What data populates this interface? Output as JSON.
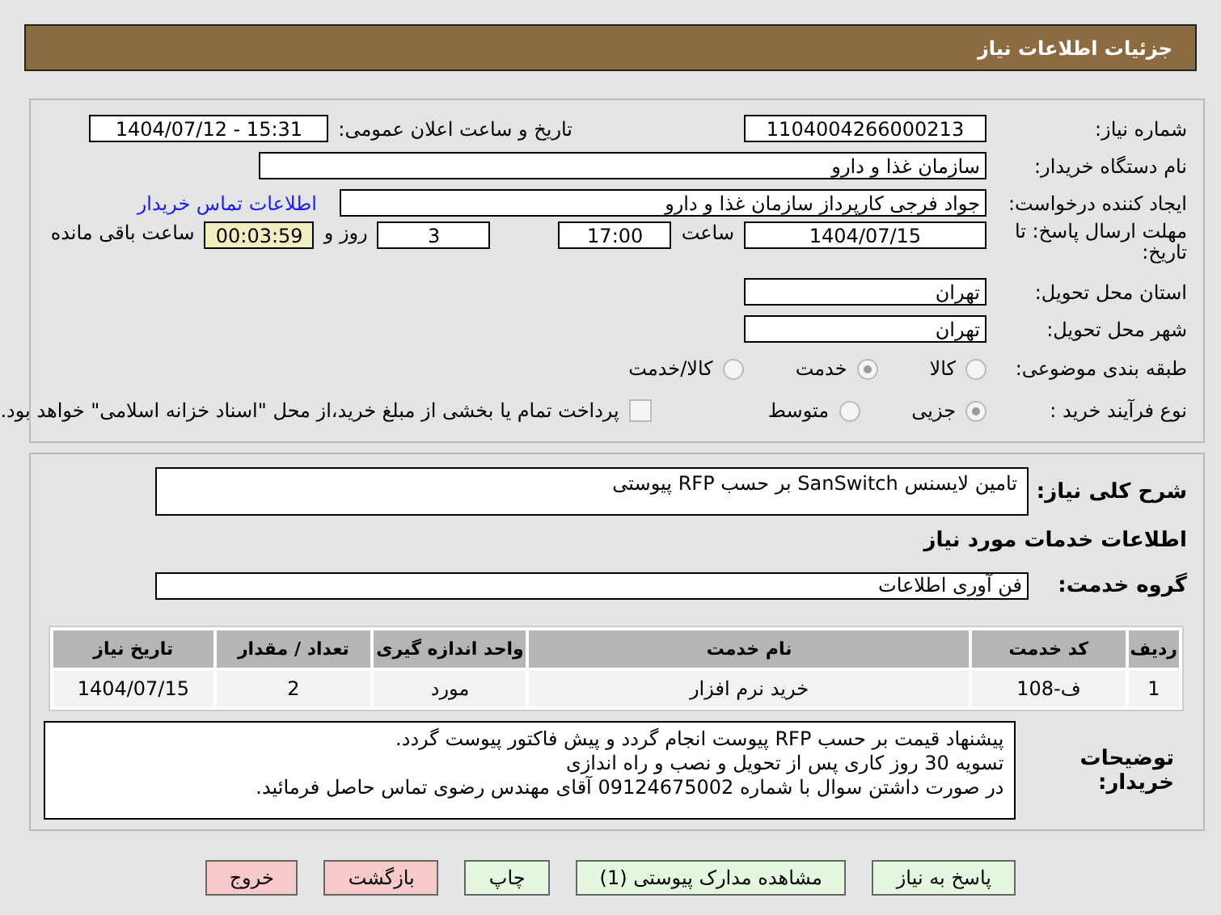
{
  "header": {
    "title": "جزئیات اطلاعات نیاز"
  },
  "need_number": {
    "label": "شماره نیاز:",
    "value": "1104004266000213"
  },
  "announce": {
    "label": "تاریخ و ساعت اعلان عمومی:",
    "value": "1404/07/12 - 15:31"
  },
  "buyer_org": {
    "label": "نام دستگاه خریدار:",
    "value": "سازمان غذا و دارو"
  },
  "requester": {
    "label": "ایجاد کننده درخواست:",
    "value": "جواد فرجی کارپرداز سازمان غذا و دارو",
    "link": "اطلاعات تماس خریدار"
  },
  "deadline": {
    "label": "مهلت ارسال پاسخ: تا تاریخ:",
    "date": "1404/07/15",
    "time_label": "ساعت",
    "time": "17:00",
    "days": "3",
    "days_label": "روز و",
    "remaining": "00:03:59",
    "remaining_label": "ساعت باقی مانده"
  },
  "province": {
    "label": "استان محل تحویل:",
    "value": "تهران"
  },
  "city": {
    "label": "شهر محل تحویل:",
    "value": "تهران"
  },
  "category": {
    "label": "طبقه بندی موضوعی:",
    "options": [
      {
        "label": "کالا",
        "selected": false
      },
      {
        "label": "خدمت",
        "selected": true
      },
      {
        "label": "کالا/خدمت",
        "selected": false
      }
    ]
  },
  "purchase_type": {
    "label": "نوع فرآیند خرید :",
    "options": [
      {
        "label": "جزیی",
        "selected": true
      },
      {
        "label": "متوسط",
        "selected": false
      }
    ],
    "payment": {
      "checked": false,
      "text": "پرداخت تمام یا بخشی از مبلغ خرید،از محل \"اسناد خزانه اسلامی\" خواهد بود."
    }
  },
  "description": {
    "label": "شرح کلی نیاز:",
    "value": "تامین لایسنس SanSwitch بر حسب RFP پیوستی"
  },
  "services_title": "اطلاعات خدمات مورد نیاز",
  "service_group": {
    "label": "گروه خدمت:",
    "value": "فن آوری اطلاعات"
  },
  "table": {
    "columns": [
      "ردیف",
      "کد خدمت",
      "نام خدمت",
      "واحد اندازه گیری",
      "تعداد / مقدار",
      "تاریخ نیاز"
    ],
    "rows": [
      [
        "1",
        "ف-108",
        "خرید نرم افزار",
        "مورد",
        "2",
        "1404/07/15"
      ]
    ]
  },
  "buyer_notes": {
    "label": "توضیحات خریدار:",
    "lines": [
      "پیشنهاد قیمت بر حسب RFP  پیوست انجام گردد و پیش فاکتور پیوست گردد.",
      "تسویه 30 روز کاری پس از تحویل و نصب و راه اندازی",
      "در صورت داشتن سوال با شماره 09124675002 آقای مهندس رضوی تماس حاصل فرمائید."
    ]
  },
  "buttons": [
    {
      "label": "پاسخ به نیاز",
      "kind": "primary"
    },
    {
      "label": "مشاهده مدارک پیوستی (1)",
      "kind": "primary"
    },
    {
      "label": "چاپ",
      "kind": "primary"
    },
    {
      "label": "بازگشت",
      "kind": "danger"
    },
    {
      "label": "خروج",
      "kind": "danger"
    }
  ]
}
